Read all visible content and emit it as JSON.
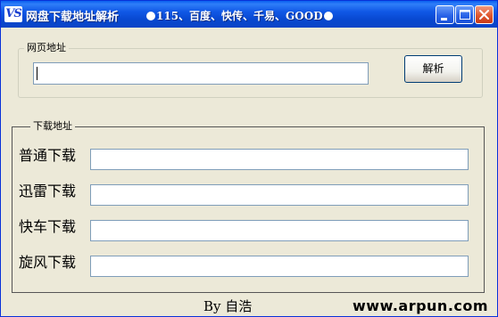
{
  "window": {
    "icon_text": "VS",
    "title": "网盘下载地址解析",
    "subtitle": "115、百度、快传、千易、GOOD"
  },
  "url_group": {
    "legend": "网页地址",
    "input_value": "",
    "parse_button": "解析"
  },
  "download_group": {
    "legend": "下载地址",
    "rows": [
      {
        "label": "普通下载",
        "value": ""
      },
      {
        "label": "迅雷下载",
        "value": ""
      },
      {
        "label": "快车下载",
        "value": ""
      },
      {
        "label": "旋风下载",
        "value": ""
      }
    ]
  },
  "footer": {
    "author": "By 自浩",
    "watermark": "www.arpun.com"
  },
  "colors": {
    "titlebar": "#0848d0",
    "window_bg": "#ece9d8",
    "input_border": "#7f9db9",
    "close_button": "#e0582e"
  }
}
